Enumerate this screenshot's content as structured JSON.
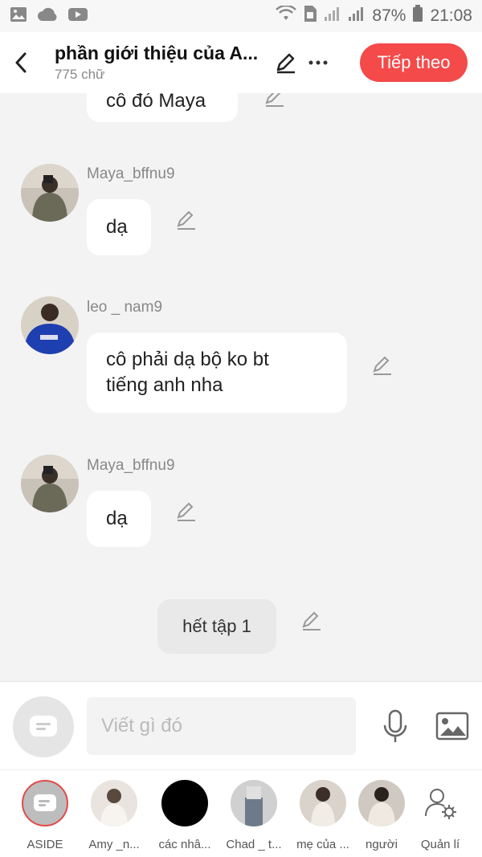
{
  "status_bar": {
    "battery": "87%",
    "time": "21:08"
  },
  "header": {
    "title": "phần giới thiệu của A...",
    "word_count": "775 chữ",
    "next_label": "Tiếp theo"
  },
  "chat": {
    "top_partial_text": "cô đó Maya",
    "messages": [
      {
        "name": "Maya_bffnu9",
        "text": "dạ"
      },
      {
        "name": "leo _ nam9",
        "text_line1": "cô phải dạ bộ ko bt",
        "text_line2": "tiếng anh nha"
      },
      {
        "name": "Maya_bffnu9",
        "text": "dạ"
      }
    ],
    "narration": "hết tập 1"
  },
  "input": {
    "placeholder": "Viết gì đó"
  },
  "characters": [
    {
      "label": "ASIDE"
    },
    {
      "label": "Amy _n..."
    },
    {
      "label": "các nhâ..."
    },
    {
      "label": "Chad _ t..."
    },
    {
      "label": "mẹ của ..."
    },
    {
      "label": "người"
    },
    {
      "label": "Quản lí"
    }
  ],
  "colors": {
    "accent": "#f44a4a",
    "bubble": "#ffffff",
    "background": "#f3f3f3"
  }
}
